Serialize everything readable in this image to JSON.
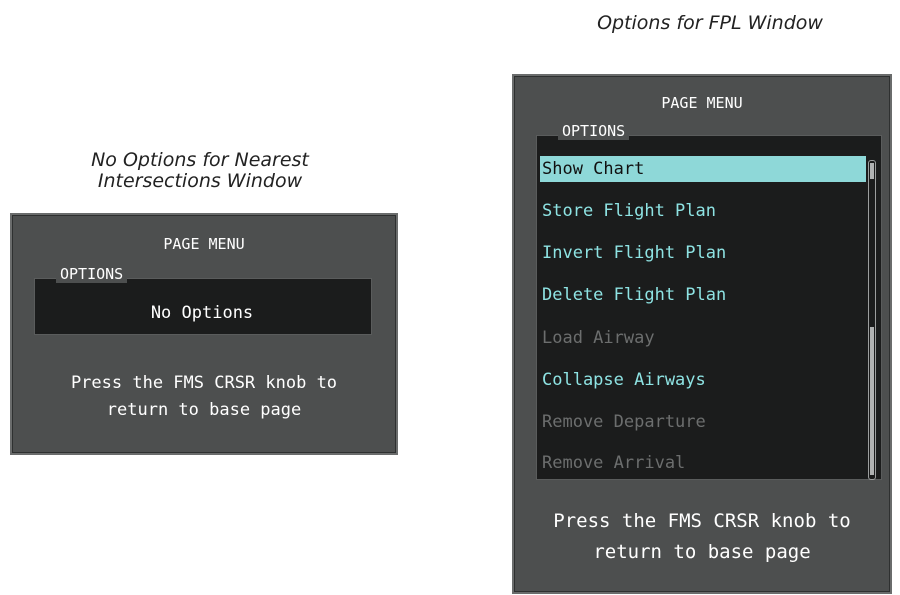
{
  "captions": {
    "left_line1": "No Options for Nearest",
    "left_line2": "Intersections Window",
    "right": "Options for FPL Window"
  },
  "left_panel": {
    "title": "PAGE MENU",
    "options_label": "OPTIONS",
    "no_options": "No Options",
    "press_line1": "Press the FMS CRSR knob to",
    "press_line2": "return to base page"
  },
  "right_panel": {
    "title": "PAGE MENU",
    "options_label": "OPTIONS",
    "items": [
      {
        "label": "Show Chart",
        "state": "selected"
      },
      {
        "label": "Store Flight Plan",
        "state": "enabled"
      },
      {
        "label": "Invert Flight Plan",
        "state": "enabled"
      },
      {
        "label": "Delete Flight Plan",
        "state": "enabled"
      },
      {
        "label": "Load Airway",
        "state": "disabled"
      },
      {
        "label": "Collapse Airways",
        "state": "enabled"
      },
      {
        "label": "Remove Departure",
        "state": "disabled"
      },
      {
        "label": "Remove Arrival",
        "state": "disabled"
      }
    ],
    "press_line1": "Press the FMS CRSR knob to",
    "press_line2": "return to base page"
  },
  "colors": {
    "panel_bg": "#4d4f4f",
    "list_bg": "#1b1c1c",
    "item_cyan": "#8ee3e3",
    "selected_bg": "#8ed8d8",
    "disabled_text": "#6c6e6e"
  }
}
